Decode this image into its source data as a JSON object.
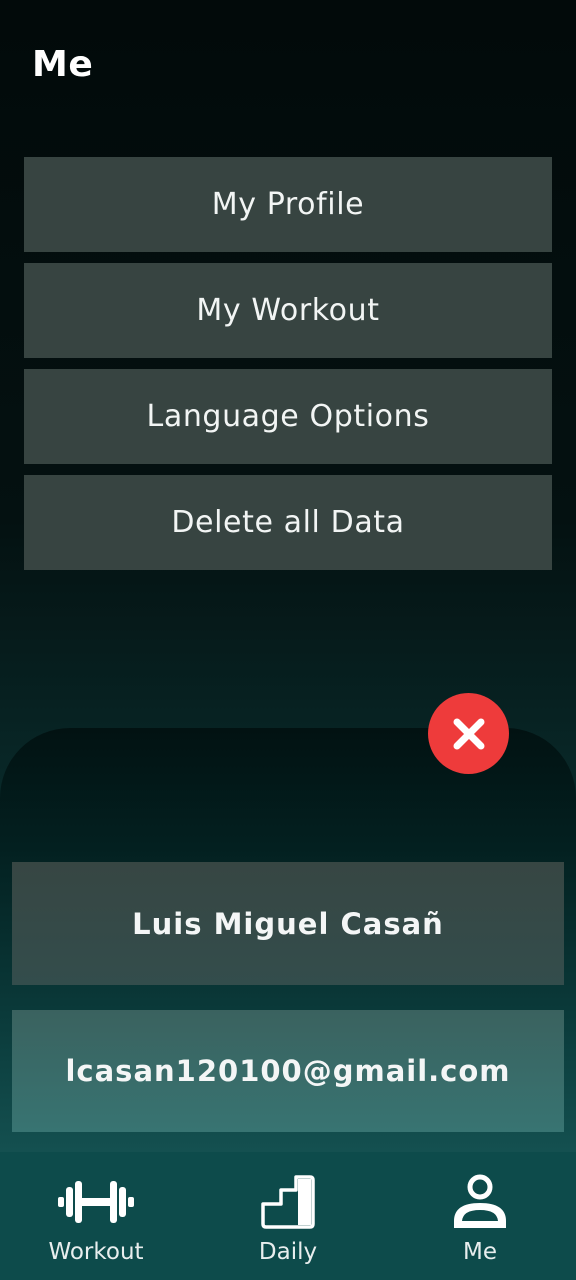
{
  "header": {
    "title": "Me"
  },
  "menu": {
    "items": [
      {
        "label": "My Profile"
      },
      {
        "label": "My Workout"
      },
      {
        "label": "Language Options"
      },
      {
        "label": "Delete all Data"
      }
    ]
  },
  "profile_sheet": {
    "close_icon": "close-icon",
    "name": "Luis Miguel Casañ",
    "email": "lcasan120100@gmail.com"
  },
  "tabbar": {
    "tabs": [
      {
        "label": "Workout",
        "icon": "dumbbell-icon"
      },
      {
        "label": "Daily",
        "icon": "steps-chart-icon"
      },
      {
        "label": "Me",
        "icon": "person-icon",
        "active": true
      }
    ]
  },
  "colors": {
    "close_button": "#ee3b3b",
    "menu_button": "#374441",
    "tabbar": "#0d4b4b"
  }
}
